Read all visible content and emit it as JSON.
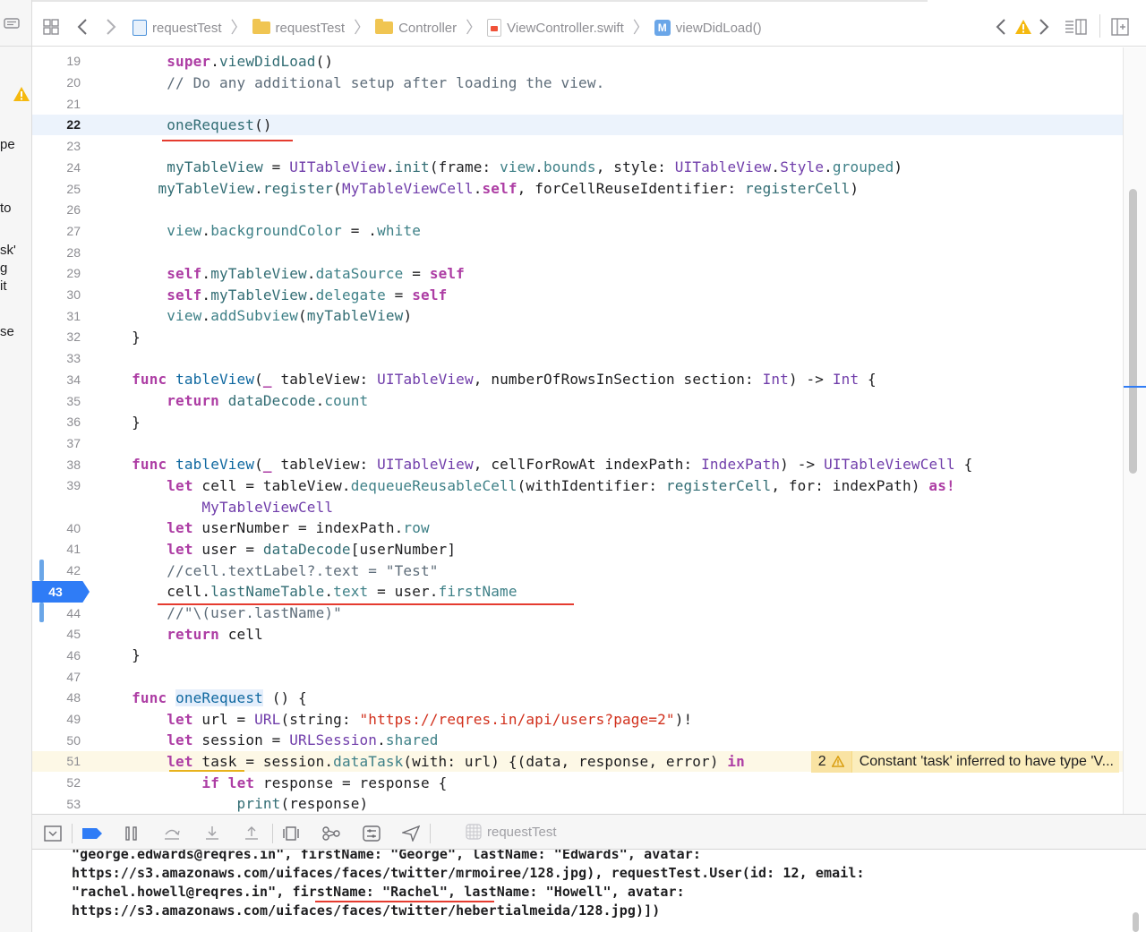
{
  "left_panel": {
    "fragments": [
      "pe",
      "to",
      "sk'",
      "g",
      "it",
      "se"
    ]
  },
  "jumpbar": {
    "crumbs": [
      {
        "label": "requestTest",
        "icon": "project-icon"
      },
      {
        "label": "requestTest",
        "icon": "folder-icon"
      },
      {
        "label": "Controller",
        "icon": "folder-icon"
      },
      {
        "label": "ViewController.swift",
        "icon": "swift-file-icon"
      },
      {
        "label": "viewDidLoad()",
        "icon": "method-icon",
        "badge": "M"
      }
    ]
  },
  "editor": {
    "current_line": 22,
    "breakpoint_line": 43,
    "warning": {
      "line": 51,
      "count": "2",
      "message": "Constant 'task' inferred to have type 'V..."
    },
    "lines": [
      {
        "n": "19",
        "t": "        super.viewDidLoad()"
      },
      {
        "n": "20",
        "t": "        // Do any additional setup after loading the view."
      },
      {
        "n": "21",
        "t": ""
      },
      {
        "n": "22",
        "t": "        oneRequest()"
      },
      {
        "n": "23",
        "t": ""
      },
      {
        "n": "24",
        "t": "        myTableView = UITableView.init(frame: view.bounds, style: UITableView.Style.grouped)"
      },
      {
        "n": "25",
        "t": "       myTableView.register(MyTableViewCell.self, forCellReuseIdentifier: registerCell)"
      },
      {
        "n": "26",
        "t": ""
      },
      {
        "n": "27",
        "t": "        view.backgroundColor = .white"
      },
      {
        "n": "28",
        "t": ""
      },
      {
        "n": "29",
        "t": "        self.myTableView.dataSource = self"
      },
      {
        "n": "30",
        "t": "        self.myTableView.delegate = self"
      },
      {
        "n": "31",
        "t": "        view.addSubview(myTableView)"
      },
      {
        "n": "32",
        "t": "    }"
      },
      {
        "n": "33",
        "t": ""
      },
      {
        "n": "34",
        "t": "    func tableView(_ tableView: UITableView, numberOfRowsInSection section: Int) -> Int {"
      },
      {
        "n": "35",
        "t": "        return dataDecode.count"
      },
      {
        "n": "36",
        "t": "    }"
      },
      {
        "n": "37",
        "t": ""
      },
      {
        "n": "38",
        "t": "    func tableView(_ tableView: UITableView, cellForRowAt indexPath: IndexPath) -> UITableViewCell {"
      },
      {
        "n": "39",
        "t": "        let cell = tableView.dequeueReusableCell(withIdentifier: registerCell, for: indexPath) as!"
      },
      {
        "n": "",
        "t": "            MyTableViewCell"
      },
      {
        "n": "40",
        "t": "        let userNumber = indexPath.row"
      },
      {
        "n": "41",
        "t": "        let user = dataDecode[userNumber]"
      },
      {
        "n": "42",
        "t": "        //cell.textLabel?.text = \"Test\""
      },
      {
        "n": "43",
        "t": "        cell.lastNameTable.text = user.firstName"
      },
      {
        "n": "44",
        "t": "        //\"\\(user.lastName)\""
      },
      {
        "n": "45",
        "t": "        return cell"
      },
      {
        "n": "46",
        "t": "    }"
      },
      {
        "n": "47",
        "t": ""
      },
      {
        "n": "48",
        "t": "    func oneRequest () {"
      },
      {
        "n": "49",
        "t": "        let url = URL(string: \"https://reqres.in/api/users?page=2\")!"
      },
      {
        "n": "50",
        "t": "        let session = URLSession.shared"
      },
      {
        "n": "51",
        "t": "        let task = session.dataTask(with: url) {(data, response, error) in"
      },
      {
        "n": "52",
        "t": "            if let response = response {"
      },
      {
        "n": "53",
        "t": "                print(response)"
      }
    ]
  },
  "debugbar": {
    "target_label": "requestTest"
  },
  "console": {
    "lines": [
      "\"george.edwards@reqres.in\", firstName: \"George\", lastName: \"Edwards\", avatar:",
      "https://s3.amazonaws.com/uifaces/faces/twitter/mrmoiree/128.jpg), requestTest.User(id: 12, email:",
      "\"rachel.howell@reqres.in\", firstName: \"Rachel\", lastName: \"Howell\", avatar:",
      "https://s3.amazonaws.com/uifaces/faces/twitter/hebertialmeida/128.jpg)])"
    ]
  },
  "colors": {
    "keyword": "#ad3da4",
    "type": "#703daa",
    "function": "#326d74",
    "property": "#3e8087",
    "comment": "#5d6c79",
    "string": "#d12f1b",
    "breakpoint": "#2f7cf6",
    "annotation_underline": "#e53b2f",
    "warning_bg": "#fbedbc"
  }
}
